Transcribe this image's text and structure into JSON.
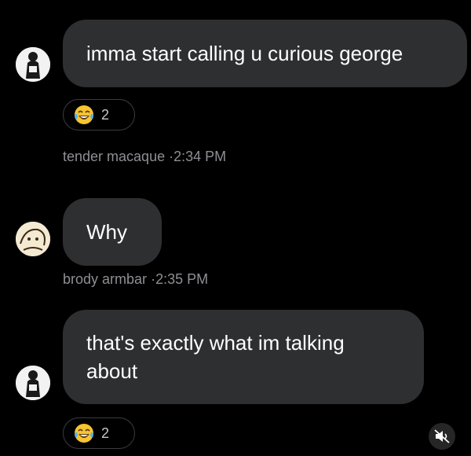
{
  "messages": [
    {
      "text": "imma start calling u curious george",
      "sender": "tender macaque",
      "time": "2:34 PM",
      "reaction": {
        "emoji": "laughing-crying-emoji",
        "count": "2"
      }
    },
    {
      "text": "Why",
      "sender": "brody armbar",
      "time": "2:35 PM"
    },
    {
      "text_lines": [
        "that's exactly what im talking",
        "about"
      ],
      "reaction": {
        "emoji": "laughing-crying-emoji",
        "count": "2"
      }
    }
  ],
  "separator": "·",
  "colors": {
    "background": "#000000",
    "bubble": "#2e2f31",
    "meta_text": "#8e8f93"
  },
  "icons": {
    "mute": "speaker-muted-icon"
  }
}
